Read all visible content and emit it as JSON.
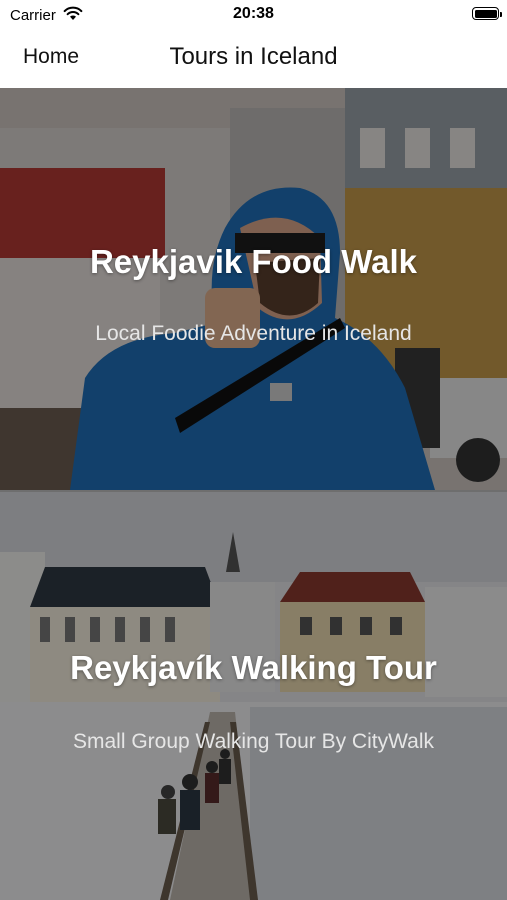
{
  "status_bar": {
    "carrier": "Carrier",
    "time": "20:38",
    "icons": [
      "wifi-icon",
      "battery-icon"
    ]
  },
  "nav": {
    "back_label": "Home",
    "title": "Tours in Iceland"
  },
  "tours": [
    {
      "title": "Reykjavik Food Walk",
      "subtitle": "Local Foodie Adventure in Iceland"
    },
    {
      "title": "Reykjavík Walking Tour",
      "subtitle": "Small Group Walking Tour By CityWalk"
    }
  ],
  "colors": {
    "nav_background": "#ffffff",
    "overlay": "#000000",
    "card_title": "#ffffff",
    "card_subtitle": "#e6e6e6"
  }
}
